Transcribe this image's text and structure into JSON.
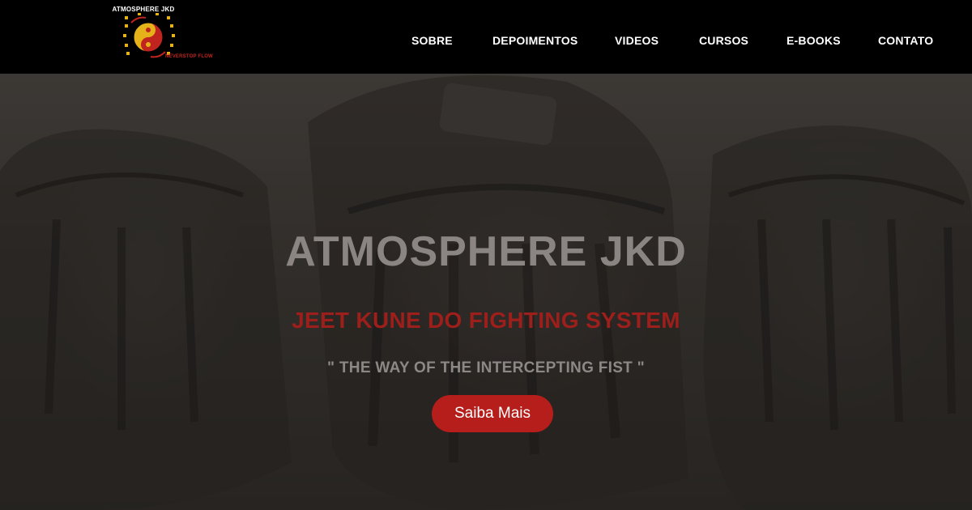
{
  "header": {
    "logo": {
      "title": "ATMOSPHERE JKD",
      "tagline": "NEVERSTOP FLOW"
    },
    "nav": [
      {
        "label": "SOBRE"
      },
      {
        "label": "DEPOIMENTOS"
      },
      {
        "label": "VIDEOS"
      },
      {
        "label": "CURSOS"
      },
      {
        "label": "E-BOOKS"
      },
      {
        "label": "CONTATO"
      }
    ]
  },
  "hero": {
    "title": "ATMOSPHERE JKD",
    "subtitle": "JEET KUNE DO FIGHTING SYSTEM",
    "quote": "\" THE WAY OF THE INTERCEPTING FIST \"",
    "button_label": "Saiba Mais",
    "background": "boxing-gloves-photo"
  },
  "colors": {
    "header_bg": "#000000",
    "accent_red": "#b51e1a",
    "subtitle_red": "#9c1f1b",
    "title_gray": "#8a8583",
    "logo_gold": "#e6b21a"
  }
}
